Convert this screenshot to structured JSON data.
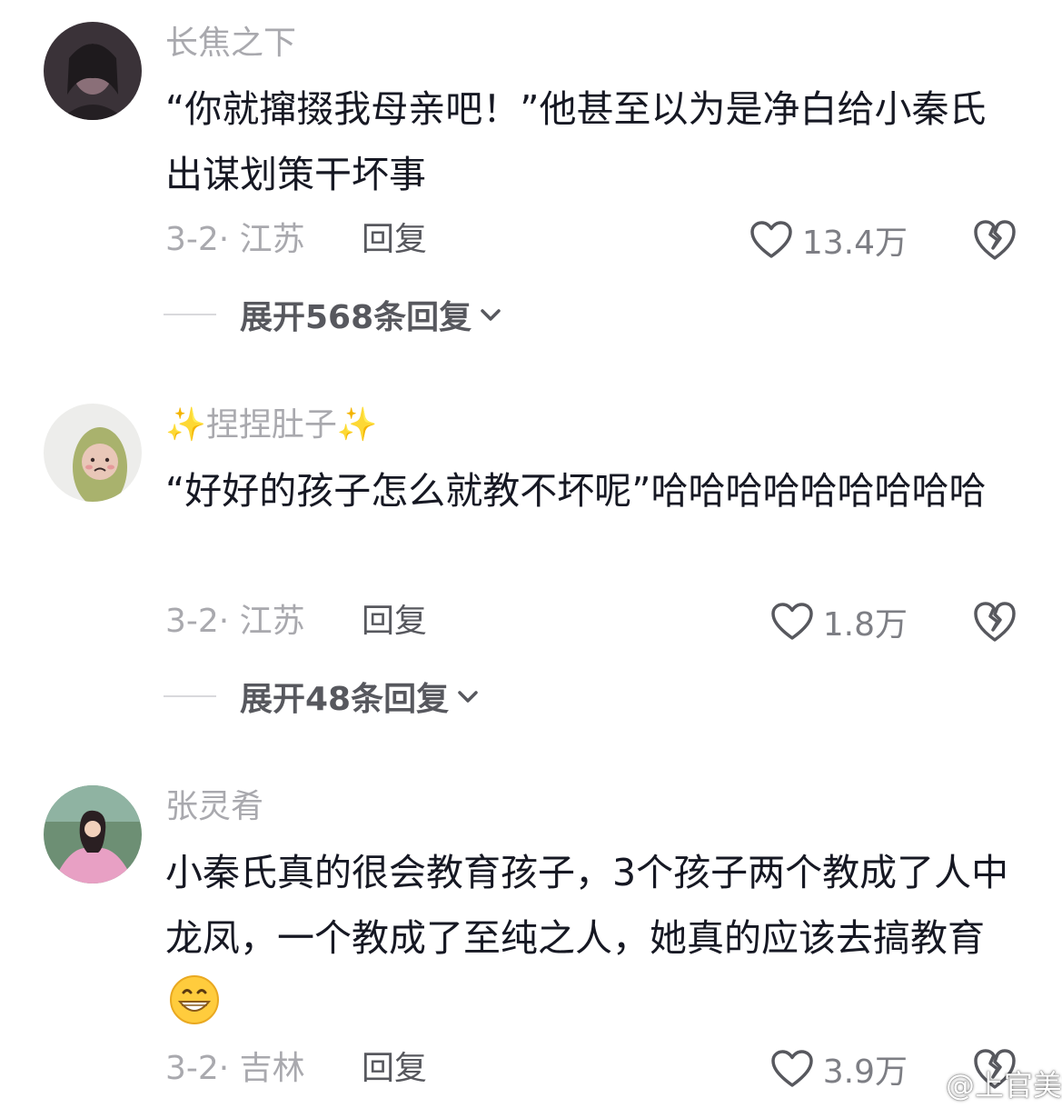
{
  "comments": [
    {
      "username": "长焦之下",
      "content": "“你就撺掇我母亲吧！”他甚至以为是净白给小秦氏出谋划策干坏事",
      "meta": "3-2· 江苏",
      "reply_label": "回复",
      "likes": "13.4万",
      "expand_label": "展开568条回复",
      "avatar_icon": "portrait-avatar"
    },
    {
      "username": "✨捏捏肚子✨",
      "content": "“好好的孩子怎么就教不坏呢”哈哈哈哈哈哈哈哈哈",
      "meta": "3-2· 江苏",
      "reply_label": "回复",
      "likes": "1.8万",
      "expand_label": "展开48条回复",
      "avatar_icon": "knitted-doll-avatar"
    },
    {
      "username": "张灵肴",
      "content": "小秦氏真的很会教育孩子，3个孩子两个教成了人中龙凤，一个教成了至纯之人，她真的应该去搞教育",
      "emoji": "grinning-face-emoji",
      "meta": "3-2· 吉林",
      "reply_label": "回复",
      "likes": "3.9万",
      "avatar_icon": "princess-avatar"
    }
  ],
  "watermark": {
    "text": "@上官美姨",
    "icon": "weibo-logo-icon"
  },
  "colors": {
    "text_primary": "#161823",
    "text_secondary": "#a9a9ae",
    "text_action": "#57585e"
  }
}
